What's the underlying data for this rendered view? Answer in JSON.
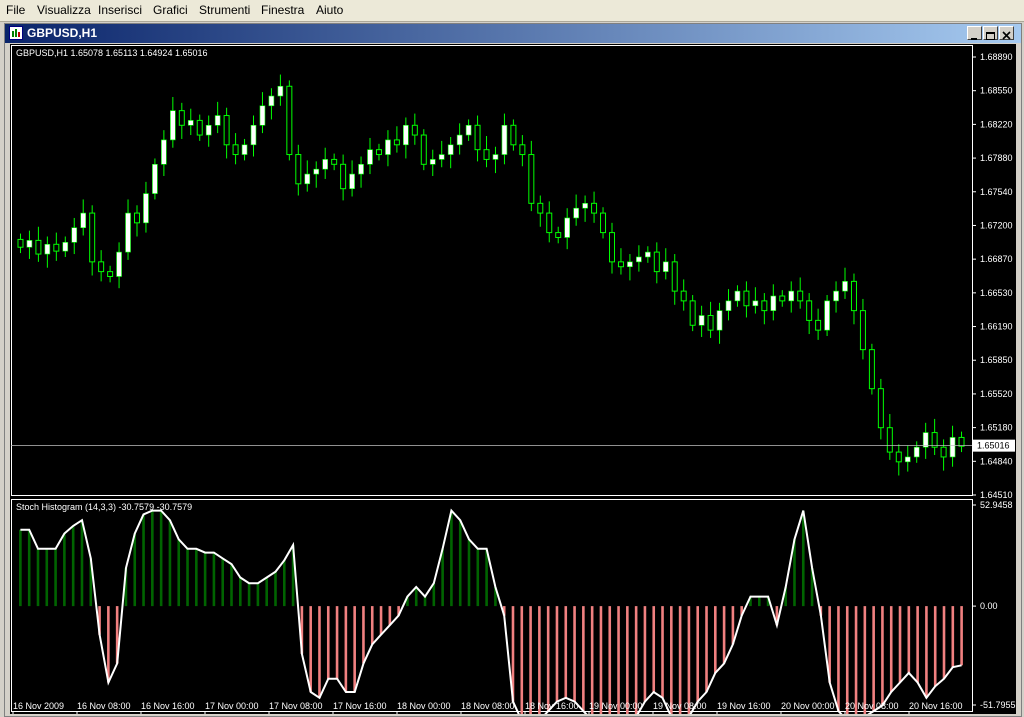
{
  "menu": [
    "File",
    "Visualizza",
    "Inserisci",
    "Grafici",
    "Strumenti",
    "Finestra",
    "Aiuto"
  ],
  "window": {
    "title": "GBPUSD,H1"
  },
  "main_header": "GBPUSD,H1  1.65078 1.65113 1.64924 1.65016",
  "indicator_header": "Stoch Histogram (14,3,3) -30.7579 -30.7579",
  "price_axis": [
    "1.68890",
    "1.68550",
    "1.68220",
    "1.67880",
    "1.67540",
    "1.67200",
    "1.66870",
    "1.66530",
    "1.66190",
    "1.65850",
    "1.65520",
    "1.65180",
    "1.64840",
    "1.64510"
  ],
  "current_price": "1.65016",
  "indicator_axis": [
    "52.9458",
    "0.00",
    "-51.7955"
  ],
  "time_axis": [
    "16 Nov 2009",
    "16 Nov 08:00",
    "16 Nov 16:00",
    "17 Nov 00:00",
    "17 Nov 08:00",
    "17 Nov 16:00",
    "18 Nov 00:00",
    "18 Nov 08:00",
    "18 Nov 16:00",
    "19 Nov 00:00",
    "19 Nov 08:00",
    "19 Nov 16:00",
    "20 Nov 00:00",
    "20 Nov 08:00",
    "20 Nov 16:00"
  ],
  "colors": {
    "bg": "#000000",
    "bull": "#ffffff",
    "wick": "#00ff00",
    "hist_pos": "#006400",
    "hist_neg": "#f08080",
    "line": "#ffffff",
    "grid": "#c0c0c0"
  },
  "chart_data": [
    {
      "type": "candlestick",
      "title": "GBPUSD,H1",
      "ylim": [
        1.6451,
        1.69
      ],
      "closes": [
        1.6705,
        1.6712,
        1.6698,
        1.6708,
        1.6701,
        1.671,
        1.6725,
        1.674,
        1.669,
        1.668,
        1.6675,
        1.67,
        1.674,
        1.673,
        1.676,
        1.679,
        1.6815,
        1.6845,
        1.683,
        1.6835,
        1.682,
        1.683,
        1.684,
        1.681,
        1.68,
        1.681,
        1.683,
        1.685,
        1.686,
        1.687,
        1.68,
        1.677,
        1.678,
        1.6785,
        1.6795,
        1.679,
        1.6765,
        1.678,
        1.679,
        1.6805,
        1.68,
        1.6815,
        1.681,
        1.683,
        1.682,
        1.679,
        1.6795,
        1.68,
        1.681,
        1.682,
        1.683,
        1.6805,
        1.6795,
        1.68,
        1.683,
        1.681,
        1.68,
        1.675,
        1.674,
        1.672,
        1.6715,
        1.6735,
        1.6745,
        1.675,
        1.674,
        1.672,
        1.669,
        1.6685,
        1.669,
        1.6695,
        1.67,
        1.668,
        1.669,
        1.666,
        1.665,
        1.6625,
        1.6635,
        1.662,
        1.664,
        1.665,
        1.666,
        1.6645,
        1.665,
        1.664,
        1.6655,
        1.665,
        1.666,
        1.665,
        1.663,
        1.662,
        1.665,
        1.666,
        1.667,
        1.664,
        1.66,
        1.656,
        1.652,
        1.6495,
        1.6485,
        1.649,
        1.65,
        1.6515,
        1.65,
        1.649,
        1.651,
        1.6501
      ]
    },
    {
      "type": "bar",
      "title": "Stoch Histogram (14,3,3)",
      "ylim": [
        -51.7955,
        52.9458
      ],
      "values": [
        40,
        40,
        30,
        30,
        30,
        38,
        42,
        45,
        25,
        -15,
        -40,
        -30,
        20,
        38,
        48,
        50,
        50,
        45,
        35,
        30,
        30,
        28,
        28,
        25,
        22,
        15,
        12,
        12,
        15,
        18,
        24,
        32,
        -25,
        -45,
        -48,
        -38,
        -38,
        -45,
        -45,
        -30,
        -20,
        -15,
        -10,
        -5,
        5,
        10,
        5,
        12,
        30,
        50,
        45,
        35,
        30,
        30,
        10,
        -5,
        -50,
        -60,
        -65,
        -60,
        -55,
        -50,
        -48,
        -50,
        -55,
        -60,
        -65,
        -65,
        -60,
        -60,
        -58,
        -50,
        -45,
        -48,
        -58,
        -60,
        -58,
        -50,
        -45,
        -35,
        -30,
        -20,
        -5,
        5,
        5,
        5,
        -10,
        10,
        35,
        50,
        20,
        -5,
        -40,
        -55,
        -60,
        -60,
        -58,
        -55,
        -52,
        -45,
        -40,
        -35,
        -40,
        -48,
        -42,
        -38,
        -32,
        -31
      ]
    }
  ]
}
